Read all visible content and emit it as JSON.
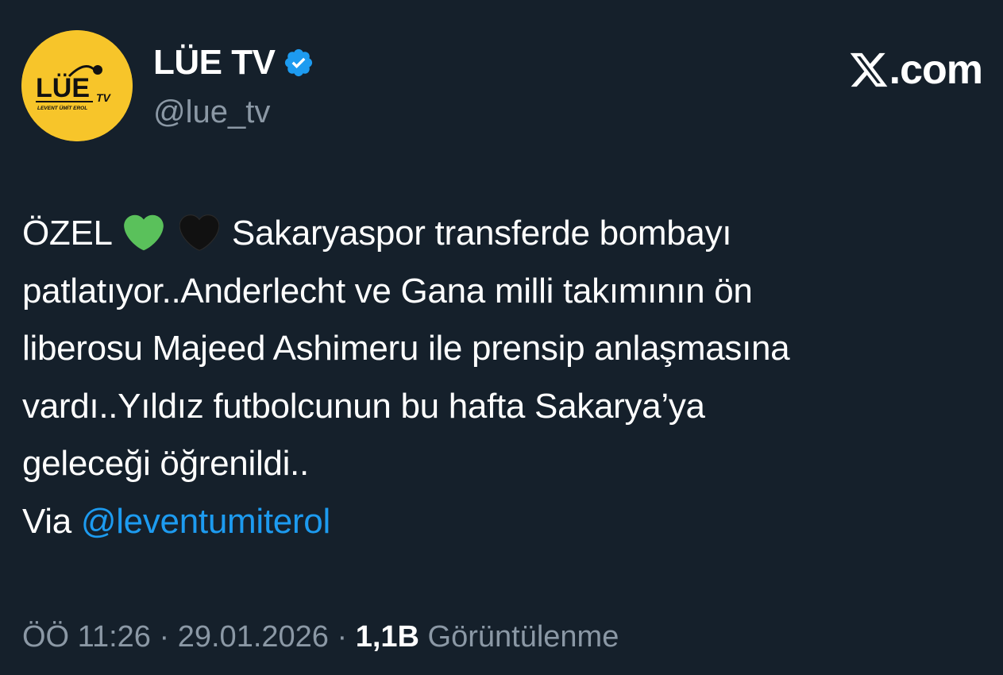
{
  "author": {
    "display_name": "LÜE TV",
    "handle": "@lue_tv",
    "avatar_text": "LÜE",
    "avatar_tv": "TV",
    "avatar_subtitle": "LEVENT ÜMİT EROL",
    "verified": true
  },
  "brand": {
    "site": ".com",
    "logo_icon": "x-logo-icon"
  },
  "tweet": {
    "line1_prefix": "ÖZEL",
    "line1_emoji_1": "green-heart-icon",
    "line1_emoji_2": "black-heart-icon",
    "line1_suffix": "Sakaryaspor transferde bombayı",
    "line2": "patlatıyor..Anderlecht ve Gana milli takımının ön",
    "line3": "liberosu Majeed Ashimeru ile prensip anlaşmasına",
    "line4": "vardı..Yıldız futbolcunun bu hafta Sakarya’ya",
    "line5": "geleceği öğrenildi..",
    "via_label": "Via",
    "via_mention": "@leventumiterol"
  },
  "meta": {
    "time": "ÖÖ 11:26",
    "separator": "·",
    "date": "29.01.2026",
    "views_count": "1,1B",
    "views_label": "Görüntülenme"
  },
  "colors": {
    "background": "#15202b",
    "accent": "#1d9bf0",
    "muted": "#8b98a5",
    "avatar_bg": "#f7c52a",
    "green_heart": "#5ac15b",
    "black_heart": "#111111"
  }
}
